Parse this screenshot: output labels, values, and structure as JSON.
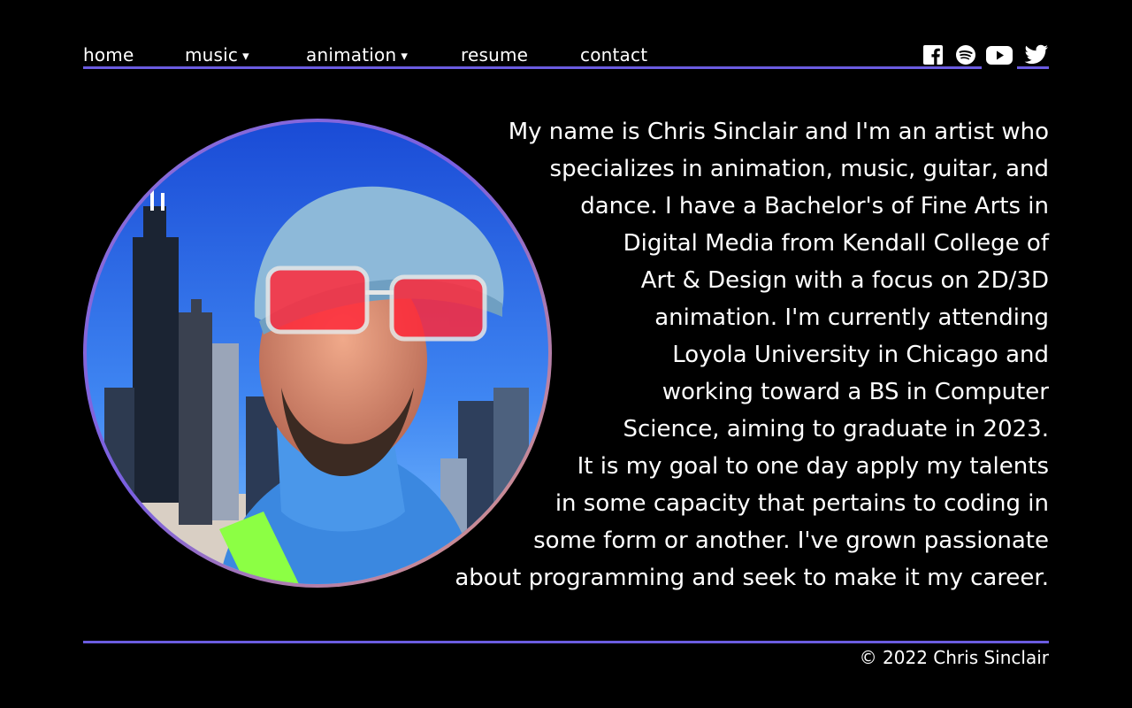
{
  "nav": {
    "items": [
      {
        "label": "home",
        "dropdown": false
      },
      {
        "label": "music",
        "dropdown": true
      },
      {
        "label": "animation",
        "dropdown": true
      },
      {
        "label": "resume",
        "dropdown": false
      },
      {
        "label": "contact",
        "dropdown": false
      }
    ],
    "caret": "▾"
  },
  "social": {
    "icons": [
      "facebook-icon",
      "spotify-icon",
      "youtube-icon",
      "twitter-icon"
    ]
  },
  "bio": {
    "lines": [
      "My name is Chris Sinclair and I'm an artist who",
      "specializes in animation, music, guitar, and",
      "dance. I have a Bachelor's of Fine Arts in",
      "Digital Media from Kendall College of",
      "Art & Design with a focus on 2D/3D",
      "animation. I'm currently attending",
      "Loyola University in Chicago and",
      "working toward a BS in Computer",
      "Science, aiming to graduate in 2023.",
      "It is my goal to one day apply my talents",
      "in some capacity that pertains to coding in",
      "some form or another. I've grown passionate",
      "about programming and seek to make it my career."
    ]
  },
  "footer": {
    "copyright": "© 2022 Chris Sinclair"
  },
  "colors": {
    "accent": "#6b5ce0",
    "background": "#000000",
    "text": "#ffffff"
  }
}
